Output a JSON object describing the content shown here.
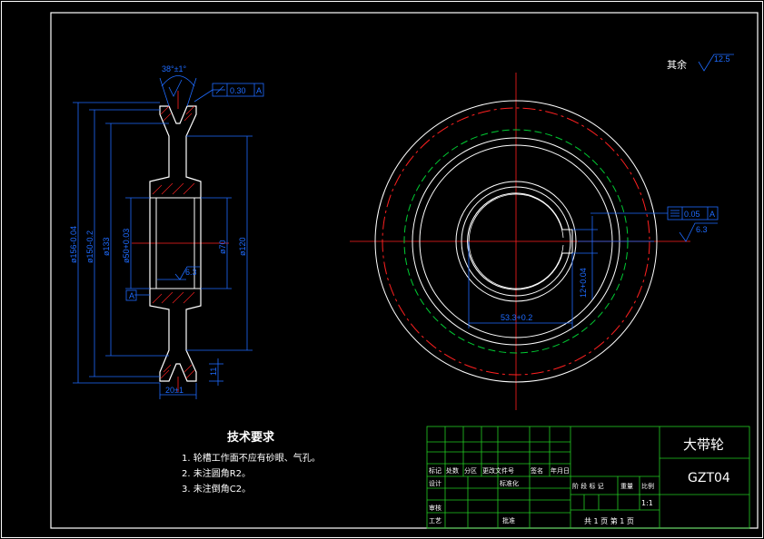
{
  "roughness_note": {
    "label": "其余",
    "value": "12.5"
  },
  "groove_angle": "38°±1°",
  "flatness": {
    "tol": "0.30",
    "datum": "A"
  },
  "left_dims": [
    "ø156-0.04",
    "ø150-0.2",
    "ø133",
    "ø50+0.03",
    "ø70",
    "ø120",
    "20±1",
    "11"
  ],
  "left_roughness": "6.3",
  "datum_label": "A",
  "right_dims": {
    "keyway_width": "53.3+0.2",
    "key_depth": "12+0.04",
    "symmetry_tol": "0.05",
    "symmetry_datum": "A",
    "roughness": "6.3"
  },
  "tech_req": {
    "title": "技术要求",
    "items": [
      "1.   轮槽工作面不应有砂眼、气孔。",
      "2.   未注圆角R2。",
      "3.   未注倒角C2。"
    ]
  },
  "title_block": {
    "part_name": "大带轮",
    "drawing_no": "GZT04",
    "scale": "1:1",
    "sheet": "共 1 页      第 1 页",
    "row1": [
      "标记",
      "处数",
      "分区",
      "更改文件号",
      "签名",
      "年月日"
    ],
    "design": "设计",
    "std": "标准化",
    "stage_labels": [
      "阶 段 标 记",
      "重量",
      "比例"
    ],
    "review": "审核",
    "process": "工艺",
    "approve": "批准"
  },
  "colors": {
    "line": "#ffffff",
    "dim": "#1e6bff",
    "center": "#ff2020",
    "hidden": "#00cc33",
    "frame": "#22cc22"
  }
}
